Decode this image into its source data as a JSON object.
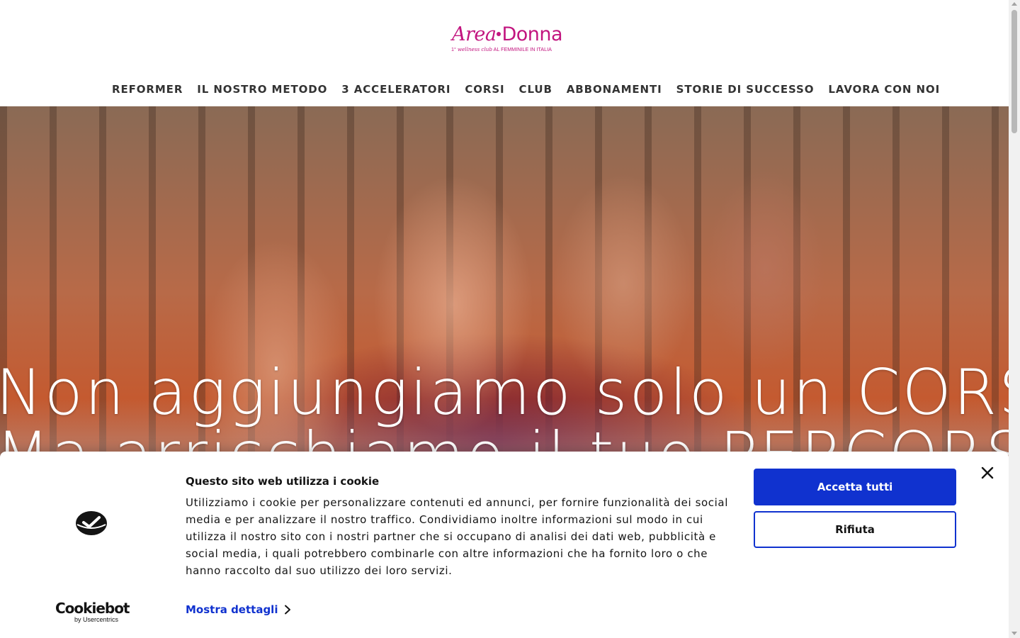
{
  "brand": {
    "name_part1": "Area",
    "name_part2": "Donna",
    "tagline_prefix": "1°",
    "tagline_script": "wellness club",
    "tagline_rest": "AL FEMMINILE IN ITALIA"
  },
  "nav": {
    "items": [
      {
        "label": "REFORMER"
      },
      {
        "label": "IL NOSTRO METODO"
      },
      {
        "label": "3 ACCELERATORI"
      },
      {
        "label": "CORSI"
      },
      {
        "label": "CLUB"
      },
      {
        "label": "ABBONAMENTI"
      },
      {
        "label": "STORIE DI SUCCESSO"
      },
      {
        "label": "LAVORA CON NOI"
      }
    ]
  },
  "hero": {
    "line1": "Non aggiungiamo solo un CORSO",
    "line2": "Ma arricchiamo il tuo PERCORSO"
  },
  "cookie_banner": {
    "title": "Questo sito web utilizza i cookie",
    "body": "Utilizziamo i cookie per personalizzare contenuti ed annunci, per fornire funzionalità dei social media e per analizzare il nostro traffico. Condividiamo inoltre informazioni sul modo in cui utilizza il nostro sito con i nostri partner che si occupano di analisi dei dati web, pubblicità e social media, i quali potrebbero combinarle con altre informazioni che ha fornito loro o che hanno raccolto dal suo utilizzo dei loro servizi.",
    "details_label": "Mostra dettagli",
    "accept_label": "Accetta tutti",
    "reject_label": "Rifiuta",
    "provider_name": "Cookiebot",
    "provider_sub": "by Usercentrics"
  },
  "colors": {
    "brand_magenta": "#c2157f",
    "cookie_blue": "#1032cf",
    "nav_text": "#333333"
  },
  "icons": [
    "cookiebot-shield-icon",
    "chevron-right-icon",
    "close-icon"
  ]
}
